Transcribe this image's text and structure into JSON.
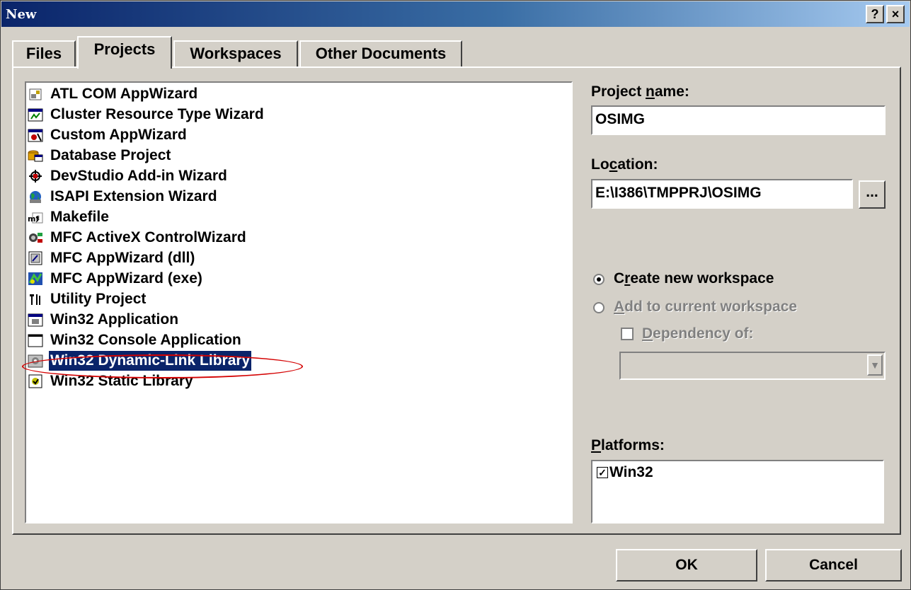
{
  "window": {
    "title": "New",
    "help_btn": "?",
    "close_btn": "×"
  },
  "tabs": [
    {
      "label": "Files",
      "active": false
    },
    {
      "label": "Projects",
      "active": true
    },
    {
      "label": "Workspaces",
      "active": false
    },
    {
      "label": "Other Documents",
      "active": false
    }
  ],
  "project_types": [
    {
      "label": "ATL COM AppWizard",
      "icon": "atl-icon"
    },
    {
      "label": "Cluster Resource Type Wizard",
      "icon": "cluster-icon"
    },
    {
      "label": "Custom AppWizard",
      "icon": "custom-wizard-icon"
    },
    {
      "label": "Database Project",
      "icon": "database-icon"
    },
    {
      "label": "DevStudio Add-in Wizard",
      "icon": "addin-icon"
    },
    {
      "label": "ISAPI Extension Wizard",
      "icon": "globe-icon"
    },
    {
      "label": "Makefile",
      "icon": "makefile-icon"
    },
    {
      "label": "MFC ActiveX ControlWizard",
      "icon": "activex-icon"
    },
    {
      "label": "MFC AppWizard (dll)",
      "icon": "mfc-dll-icon"
    },
    {
      "label": "MFC AppWizard (exe)",
      "icon": "mfc-exe-icon"
    },
    {
      "label": "Utility Project",
      "icon": "utility-icon"
    },
    {
      "label": "Win32 Application",
      "icon": "win32-app-icon"
    },
    {
      "label": "Win32 Console Application",
      "icon": "console-icon"
    },
    {
      "label": "Win32 Dynamic-Link Library",
      "icon": "dll-icon",
      "selected": true
    },
    {
      "label": "Win32 Static Library",
      "icon": "static-lib-icon"
    }
  ],
  "project_name": {
    "label_pre": "Project ",
    "label_key": "n",
    "label_post": "ame:",
    "value": "OSIMG"
  },
  "location": {
    "label_pre": "Lo",
    "label_key": "c",
    "label_post": "ation:",
    "value": "E:\\I386\\TMPPRJ\\OSIMG",
    "browse": "..."
  },
  "workspace": {
    "create": {
      "pre": "C",
      "key": "r",
      "post": "eate new workspace",
      "checked": true
    },
    "add": {
      "key": "A",
      "post": "dd to current workspace",
      "enabled": false
    },
    "dependency": {
      "key": "D",
      "post": "ependency of:",
      "enabled": false
    }
  },
  "platforms": {
    "label_key": "P",
    "label_post": "latforms:",
    "items": [
      {
        "label": "Win32",
        "checked": true
      }
    ]
  },
  "buttons": {
    "ok": "OK",
    "cancel": "Cancel"
  },
  "colors": {
    "title_start": "#0a246a",
    "title_end": "#a6caf0",
    "selection": "#0a246a",
    "annotation": "#d40000"
  }
}
